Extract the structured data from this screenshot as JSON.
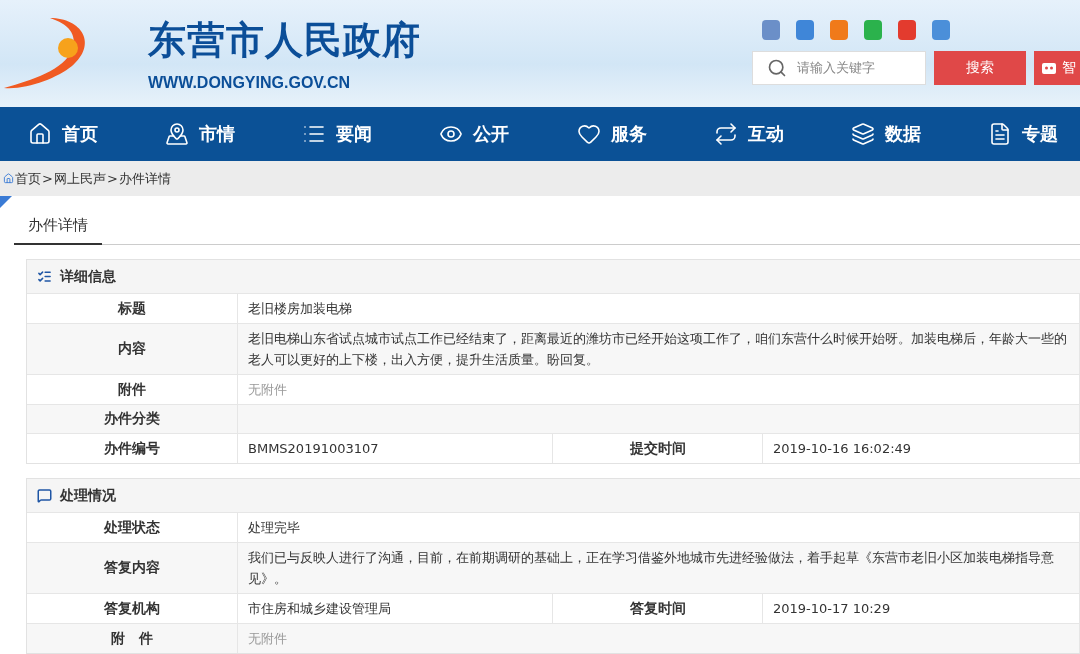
{
  "header": {
    "title": "东营市人民政府",
    "url": "WWW.DONGYING.GOV.CN",
    "search": {
      "placeholder": "请输入关键字"
    },
    "search_button": "搜索",
    "smart_button": "智"
  },
  "nav": [
    {
      "label": "首页",
      "kind": "home"
    },
    {
      "label": "市情",
      "kind": "map"
    },
    {
      "label": "要闻",
      "kind": "list"
    },
    {
      "label": "公开",
      "kind": "eye"
    },
    {
      "label": "服务",
      "kind": "heart"
    },
    {
      "label": "互动",
      "kind": "interact"
    },
    {
      "label": "数据",
      "kind": "layers"
    },
    {
      "label": "专题",
      "kind": "doc"
    }
  ],
  "breadcrumb": [
    "首页",
    ">",
    "网上民声",
    ">",
    "办件详情"
  ],
  "page_tab": "办件详情",
  "sections": [
    {
      "title": "详细信息",
      "kind": "info",
      "rows": [
        {
          "fields": [
            {
              "label": "标题",
              "value": "老旧楼房加装电梯"
            }
          ]
        },
        {
          "fields": [
            {
              "label": "内容",
              "value": "老旧电梯山东省试点城市试点工作已经结束了，距离最近的潍坊市已经开始这项工作了，咱们东营什么时候开始呀。加装电梯后，年龄大一些的老人可以更好的上下楼，出入方便，提升生活质量。盼回复。"
            }
          ]
        },
        {
          "fields": [
            {
              "label": "附件",
              "value": "无附件",
              "muted": true
            }
          ]
        },
        {
          "fields": [
            {
              "label": "办件分类"
            }
          ]
        },
        {
          "fields": [
            {
              "label": "办件编号",
              "value": "BMMS20191003107"
            },
            {
              "label": "提交时间",
              "value": "2019-10-16 16:02:49"
            }
          ]
        }
      ]
    },
    {
      "title": "处理情况",
      "kind": "process",
      "rows": [
        {
          "fields": [
            {
              "label": "处理状态",
              "value": "处理完毕"
            }
          ]
        },
        {
          "fields": [
            {
              "label": "答复内容",
              "value": "我们已与反映人进行了沟通，目前，在前期调研的基础上，正在学习借鉴外地城市先进经验做法，着手起草《东营市老旧小区加装电梯指导意见》。"
            }
          ]
        },
        {
          "fields": [
            {
              "label": "答复机构",
              "value": "市住房和城乡建设管理局"
            },
            {
              "label": "答复时间",
              "value": "2019-10-17 10:29"
            }
          ]
        },
        {
          "fields": [
            {
              "label": "附　件",
              "value": "无附件",
              "muted": true
            }
          ]
        }
      ]
    }
  ]
}
